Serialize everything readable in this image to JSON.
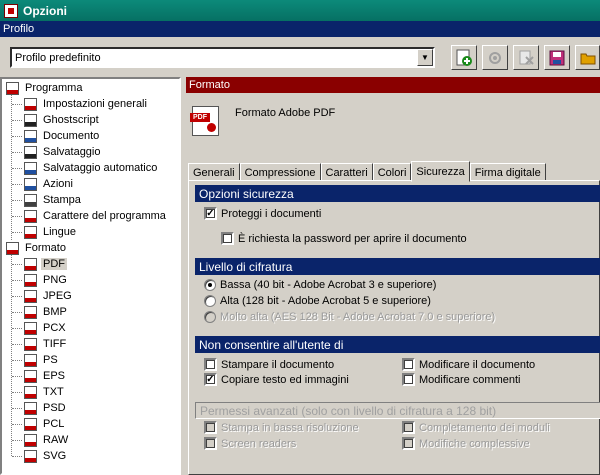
{
  "window": {
    "title": "Opzioni"
  },
  "profile": {
    "section_label": "Profilo",
    "selected": "Profilo predefinito",
    "toolbar": [
      {
        "icon": "add-profile-icon",
        "color": "#1a8a1a",
        "enabled": true
      },
      {
        "icon": "settings-profile-icon",
        "color": "#a0a0a0",
        "enabled": false
      },
      {
        "icon": "delete-profile-icon",
        "color": "#a0a0a0",
        "enabled": false
      },
      {
        "icon": "save-icon",
        "color": "#c0307a",
        "enabled": true
      },
      {
        "icon": "open-folder-icon",
        "color": "#e0a000",
        "enabled": true
      }
    ]
  },
  "tree": {
    "items": [
      {
        "label": "Programma",
        "icon": "program-icon",
        "level": 0
      },
      {
        "label": "Impostazioni generali",
        "icon": "general-settings-icon",
        "level": 1
      },
      {
        "label": "Ghostscript",
        "icon": "ghostscript-icon",
        "level": 1
      },
      {
        "label": "Documento",
        "icon": "document-icon",
        "level": 1
      },
      {
        "label": "Salvataggio",
        "icon": "save-icon",
        "level": 1
      },
      {
        "label": "Salvataggio automatico",
        "icon": "autosave-icon",
        "level": 1
      },
      {
        "label": "Azioni",
        "icon": "actions-icon",
        "level": 1
      },
      {
        "label": "Stampa",
        "icon": "printer-icon",
        "level": 1
      },
      {
        "label": "Carattere del programma",
        "icon": "font-icon",
        "level": 1
      },
      {
        "label": "Lingue",
        "icon": "flag-icon",
        "level": 1
      },
      {
        "label": "Formato",
        "icon": "format-icon",
        "level": 0
      },
      {
        "label": "PDF",
        "icon": "pdf-icon",
        "level": 1,
        "selected": true
      },
      {
        "label": "PNG",
        "icon": "png-icon",
        "level": 1
      },
      {
        "label": "JPEG",
        "icon": "jpeg-icon",
        "level": 1
      },
      {
        "label": "BMP",
        "icon": "bmp-icon",
        "level": 1
      },
      {
        "label": "PCX",
        "icon": "pcx-icon",
        "level": 1
      },
      {
        "label": "TIFF",
        "icon": "tiff-icon",
        "level": 1
      },
      {
        "label": "PS",
        "icon": "ps-icon",
        "level": 1
      },
      {
        "label": "EPS",
        "icon": "eps-icon",
        "level": 1
      },
      {
        "label": "TXT",
        "icon": "txt-icon",
        "level": 1
      },
      {
        "label": "PSD",
        "icon": "psd-icon",
        "level": 1
      },
      {
        "label": "PCL",
        "icon": "pcl-icon",
        "level": 1
      },
      {
        "label": "RAW",
        "icon": "raw-icon",
        "level": 1
      },
      {
        "label": "SVG",
        "icon": "svg-icon",
        "level": 1
      }
    ]
  },
  "format": {
    "section_label": "Formato",
    "title": "Formato Adobe PDF",
    "icon_tag": "PDF",
    "tabs": [
      {
        "label": "Generali",
        "active": false
      },
      {
        "label": "Compressione",
        "active": false
      },
      {
        "label": "Caratteri",
        "active": false
      },
      {
        "label": "Colori",
        "active": false
      },
      {
        "label": "Sicurezza",
        "active": true
      },
      {
        "label": "Firma digitale",
        "active": false
      }
    ]
  },
  "security": {
    "title": "Opzioni sicurezza",
    "protect": {
      "label": "Proteggi i documenti",
      "checked": true
    },
    "require_open_password": {
      "label": "È richiesta la password per aprire il documento",
      "checked": false
    },
    "encryption": {
      "title": "Livello di cifratura",
      "options": [
        {
          "label": "Bassa (40 bit - Adobe Acrobat 3 e superiore)",
          "selected": true,
          "enabled": true
        },
        {
          "label": "Alta (128 bit - Adobe Acrobat 5 e superiore)",
          "selected": false,
          "enabled": true
        },
        {
          "label": "Molto alta (AES 128 Bit - Adobe Acrobat 7.0 e superiore)",
          "selected": false,
          "enabled": false
        }
      ]
    },
    "restrictions": {
      "title": "Non consentire all'utente di",
      "print": {
        "label": "Stampare il documento",
        "checked": false
      },
      "copy": {
        "label": "Copiare testo ed immagini",
        "checked": true
      },
      "modify": {
        "label": "Modificare il documento",
        "checked": false
      },
      "comments": {
        "label": "Modificare commenti",
        "checked": false
      }
    },
    "advanced": {
      "title": "Permessi avanzati (solo con livello di cifratura a 128 bit)",
      "low_res_print": {
        "label": "Stampa in bassa risoluzione",
        "checked": false
      },
      "screen_readers": {
        "label": "Screen readers",
        "checked": false
      },
      "fill_forms": {
        "label": "Completamento dei moduli",
        "checked": false
      },
      "assembly": {
        "label": "Modifiche complessive",
        "checked": false
      }
    }
  }
}
